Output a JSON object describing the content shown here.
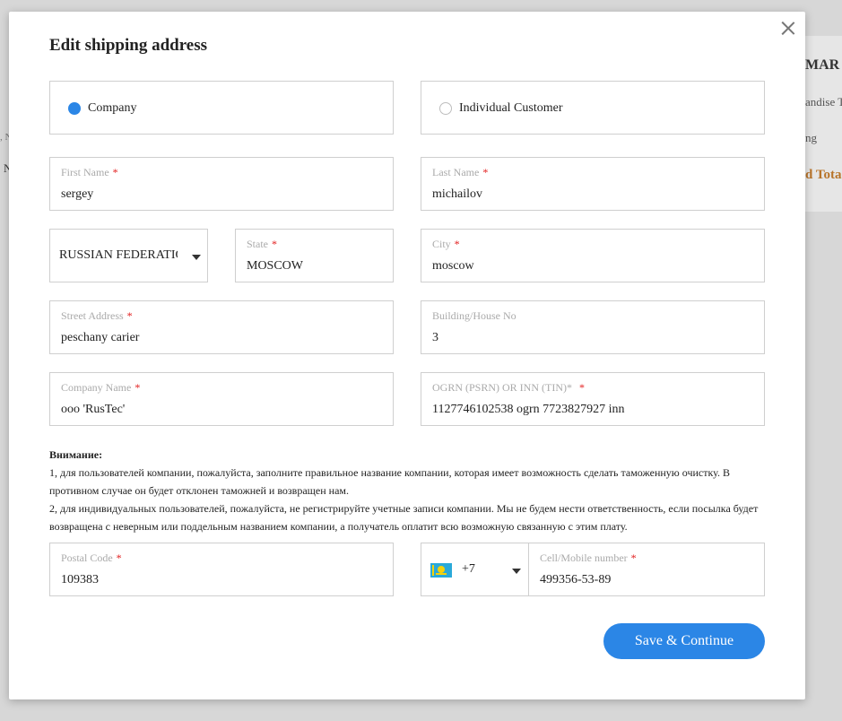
{
  "background": {
    "summary_title": "MAR",
    "summary_line1": "andise T",
    "summary_line2": "ng",
    "summary_total": "d Tota",
    "left_text1": ", N",
    "left_text2": "N"
  },
  "modal": {
    "title": "Edit shipping address",
    "close_icon": "close-icon"
  },
  "customer_type": {
    "options": [
      {
        "label": "Company",
        "selected": true
      },
      {
        "label": "Individual Customer",
        "selected": false
      }
    ]
  },
  "fields": {
    "first_name": {
      "label": "First Name",
      "required": "*",
      "value": "sergey"
    },
    "last_name": {
      "label": "Last Name",
      "required": "*",
      "value": "michailov"
    },
    "country": {
      "value": "RUSSIAN FEDERATION"
    },
    "state": {
      "label": "State",
      "required": "*",
      "value": "MOSCOW"
    },
    "city": {
      "label": "City",
      "required": "*",
      "value": "moscow"
    },
    "street": {
      "label": "Street Address",
      "required": "*",
      "value": "peschany carier"
    },
    "building": {
      "label": "Building/House No",
      "value": "3"
    },
    "company_name": {
      "label": "Company Name",
      "required": "*",
      "value": "ooo 'RusTec'"
    },
    "ogrn": {
      "label": "OGRN (PSRN) OR INN (TIN)*",
      "required": "*",
      "value": "1127746102538 ogrn 7723827927 inn"
    },
    "postal_code": {
      "label": "Postal Code",
      "required": "*",
      "value": "109383"
    },
    "phone_code": {
      "value": "+7",
      "flag_icon": "kazakhstan-flag-icon"
    },
    "mobile": {
      "label": "Cell/Mobile number",
      "required": "*",
      "value": "499356-53-89"
    }
  },
  "notice": {
    "heading": "Внимание:",
    "line1": "1, для пользователей компании, пожалуйста, заполните правильное название компании, которая имеет возможность сделать таможенную очистку. В противном случае он будет отклонен таможней и возвращен нам.",
    "line2": "2, для индивидуальных пользователей, пожалуйста, не регистрируйте учетные записи компании. Мы не будем нести ответственность, если посылка будет возвращена с неверным или поддельным названием компании, а получатель оплатит всю возможную связанную с этим плату."
  },
  "actions": {
    "save_label": "Save & Continue"
  },
  "colors": {
    "accent": "#2b86e6",
    "required": "#e21a1a",
    "label_gray": "#aaaaaa",
    "total_orange": "#b8742a"
  }
}
